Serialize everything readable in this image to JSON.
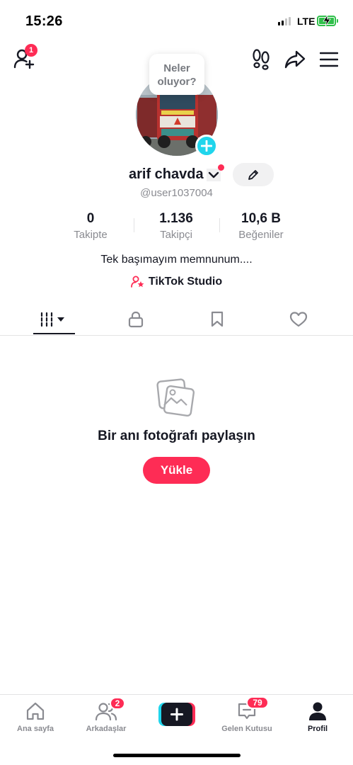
{
  "status_bar": {
    "time": "15:26",
    "network": "LTE"
  },
  "header": {
    "notification_count": "1"
  },
  "profile": {
    "bubble_text": "Neler oluyor?",
    "username": "arif chavda",
    "handle": "@user1037004",
    "bio": "Tek başımayım memnunum....",
    "studio_label": "TikTok Studio"
  },
  "stats": [
    {
      "value": "0",
      "label": "Takipte"
    },
    {
      "value": "1.136",
      "label": "Takipçi"
    },
    {
      "value": "10,6 B",
      "label": "Beğeniler"
    }
  ],
  "tabs": [
    "videos-grid-icon",
    "lock-icon",
    "bookmark-icon",
    "heart-icon"
  ],
  "empty_state": {
    "title": "Bir anı fotoğrafı paylaşın",
    "button": "Yükle"
  },
  "bottom_nav": {
    "items": [
      {
        "label": "Ana sayfa"
      },
      {
        "label": "Arkadaşlar",
        "badge": "2"
      },
      {
        "label": "Gelen Kutusu",
        "badge": "79"
      },
      {
        "label": "Profil"
      }
    ]
  },
  "colors": {
    "accent": "#fe2c55",
    "teal": "#20d5ec",
    "text": "#161823",
    "muted": "#8a8b91",
    "battery": "#2fbf4a"
  }
}
